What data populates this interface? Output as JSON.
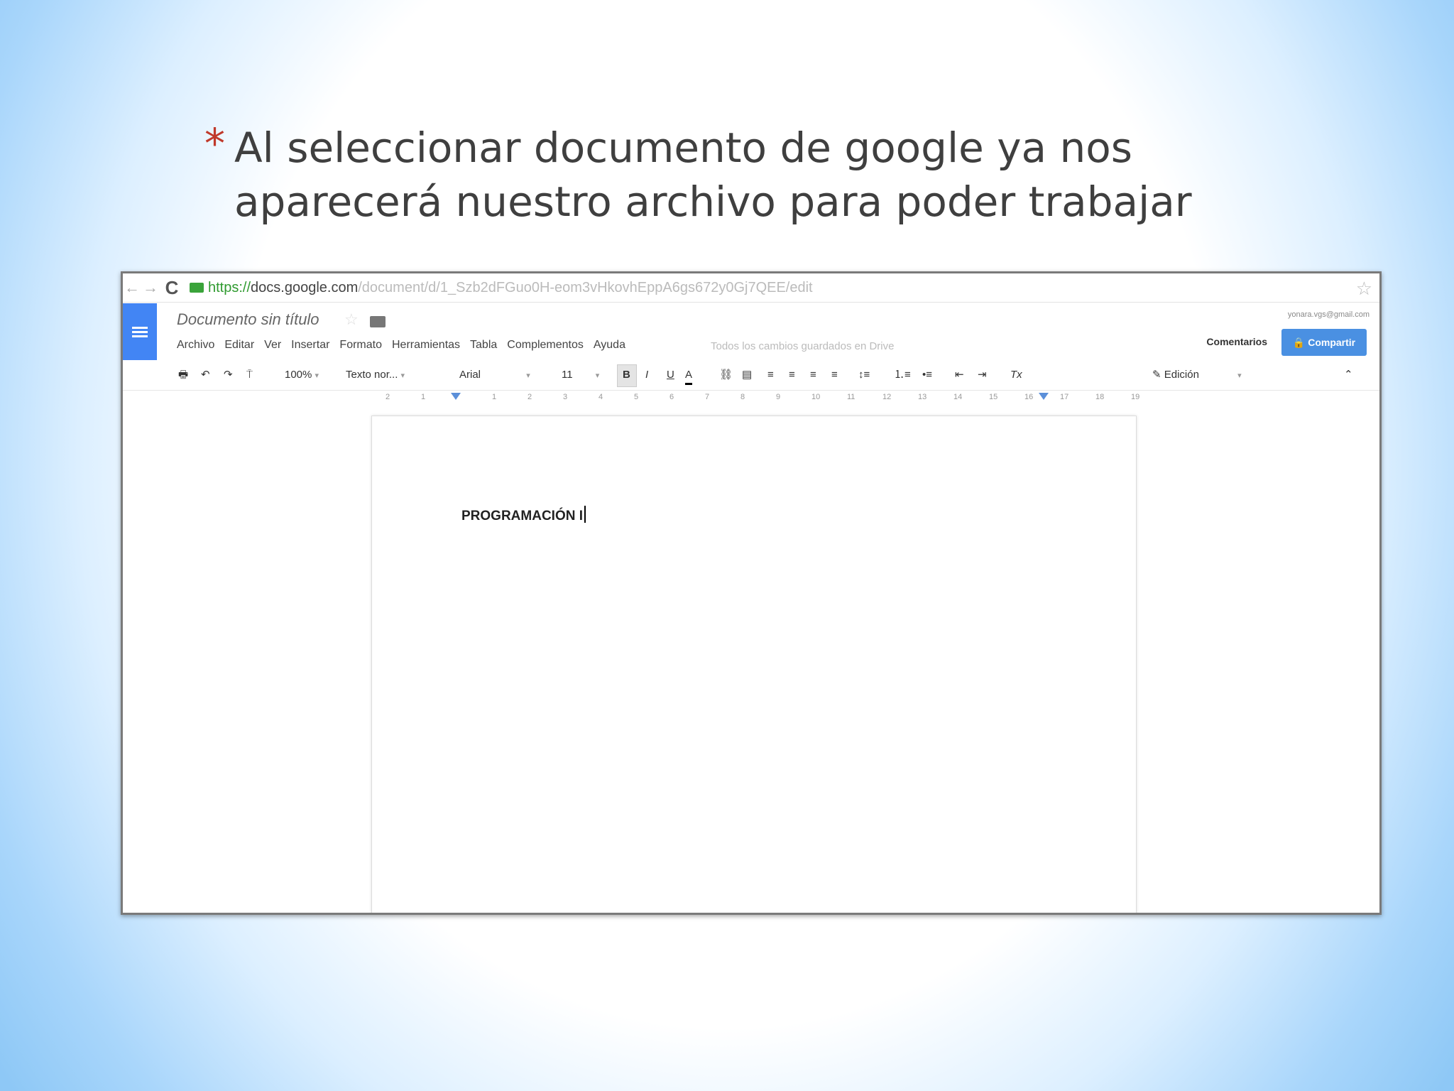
{
  "slide": {
    "bullet_symbol": "*",
    "line1": "Al seleccionar documento de google ya nos",
    "line2": "aparecerá nuestro archivo para poder trabajar"
  },
  "browser": {
    "back_icon": "←",
    "forward_icon": "→",
    "reload_icon": "C",
    "url_https": "https://",
    "url_host": "docs.google.com",
    "url_path": "/document/d/1_Szb2dFGuo0H-eom3vHkovhEppA6gs672y0Gj7QEE/edit",
    "star_icon": "☆"
  },
  "docs": {
    "title": "Documento sin título",
    "user_email": "yonara.vgs@gmail.com",
    "menu": [
      "Archivo",
      "Editar",
      "Ver",
      "Insertar",
      "Formato",
      "Herramientas",
      "Tabla",
      "Complementos",
      "Ayuda"
    ],
    "saved_status": "Todos los cambios guardados en Drive",
    "comments_label": "Comentarios",
    "share_label": "🔒 Compartir",
    "toolbar": {
      "zoom": "100%",
      "style": "Texto nor...",
      "font": "Arial",
      "size": "11",
      "bold": "B",
      "italic": "I",
      "underline": "U",
      "text_color": "A",
      "clear_format": "Tx",
      "mode": "Edición"
    },
    "ruler_numbers": [
      "2",
      "1",
      "1",
      "2",
      "3",
      "4",
      "5",
      "6",
      "7",
      "8",
      "9",
      "10",
      "11",
      "12",
      "13",
      "14",
      "15",
      "16",
      "17",
      "18",
      "19"
    ],
    "body_text": "PROGRAMACIÓN I"
  }
}
